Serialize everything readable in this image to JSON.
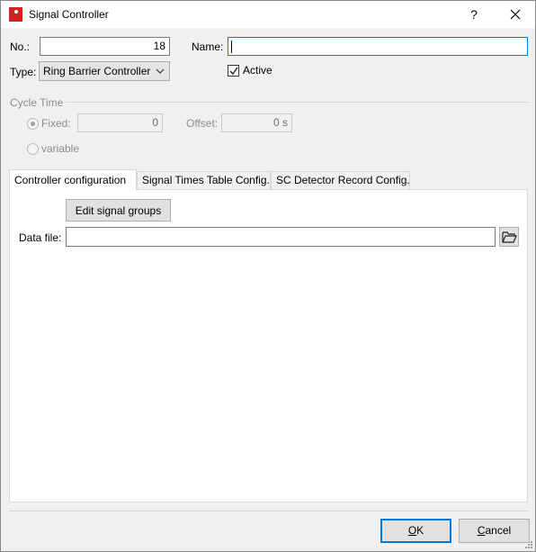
{
  "window": {
    "title": "Signal Controller",
    "help_glyph": "?",
    "icon": "signal-controller-icon"
  },
  "form": {
    "no_label": "No.:",
    "no_value": "18",
    "name_label": "Name:",
    "name_value": "",
    "type_label": "Type:",
    "type_value": "Ring Barrier Controller",
    "active_label": "Active",
    "active_checked": true
  },
  "cycle_time": {
    "group_label": "Cycle Time",
    "fixed_label": "Fixed:",
    "fixed_value": "0",
    "fixed_selected": true,
    "offset_label": "Offset:",
    "offset_value": "0 s",
    "variable_label": "variable",
    "variable_selected": false,
    "enabled": false
  },
  "tabs": [
    {
      "label": "Controller configuration",
      "active": true
    },
    {
      "label": "Signal Times Table Config.",
      "active": false
    },
    {
      "label": "SC Detector Record Config.",
      "active": false
    }
  ],
  "controller_config": {
    "edit_signal_groups_label": "Edit signal groups",
    "data_file_label": "Data file:",
    "data_file_value": ""
  },
  "footer": {
    "ok_label": "OK",
    "ok_mnemonic": "O",
    "cancel_label": "Cancel",
    "cancel_mnemonic": "C"
  }
}
